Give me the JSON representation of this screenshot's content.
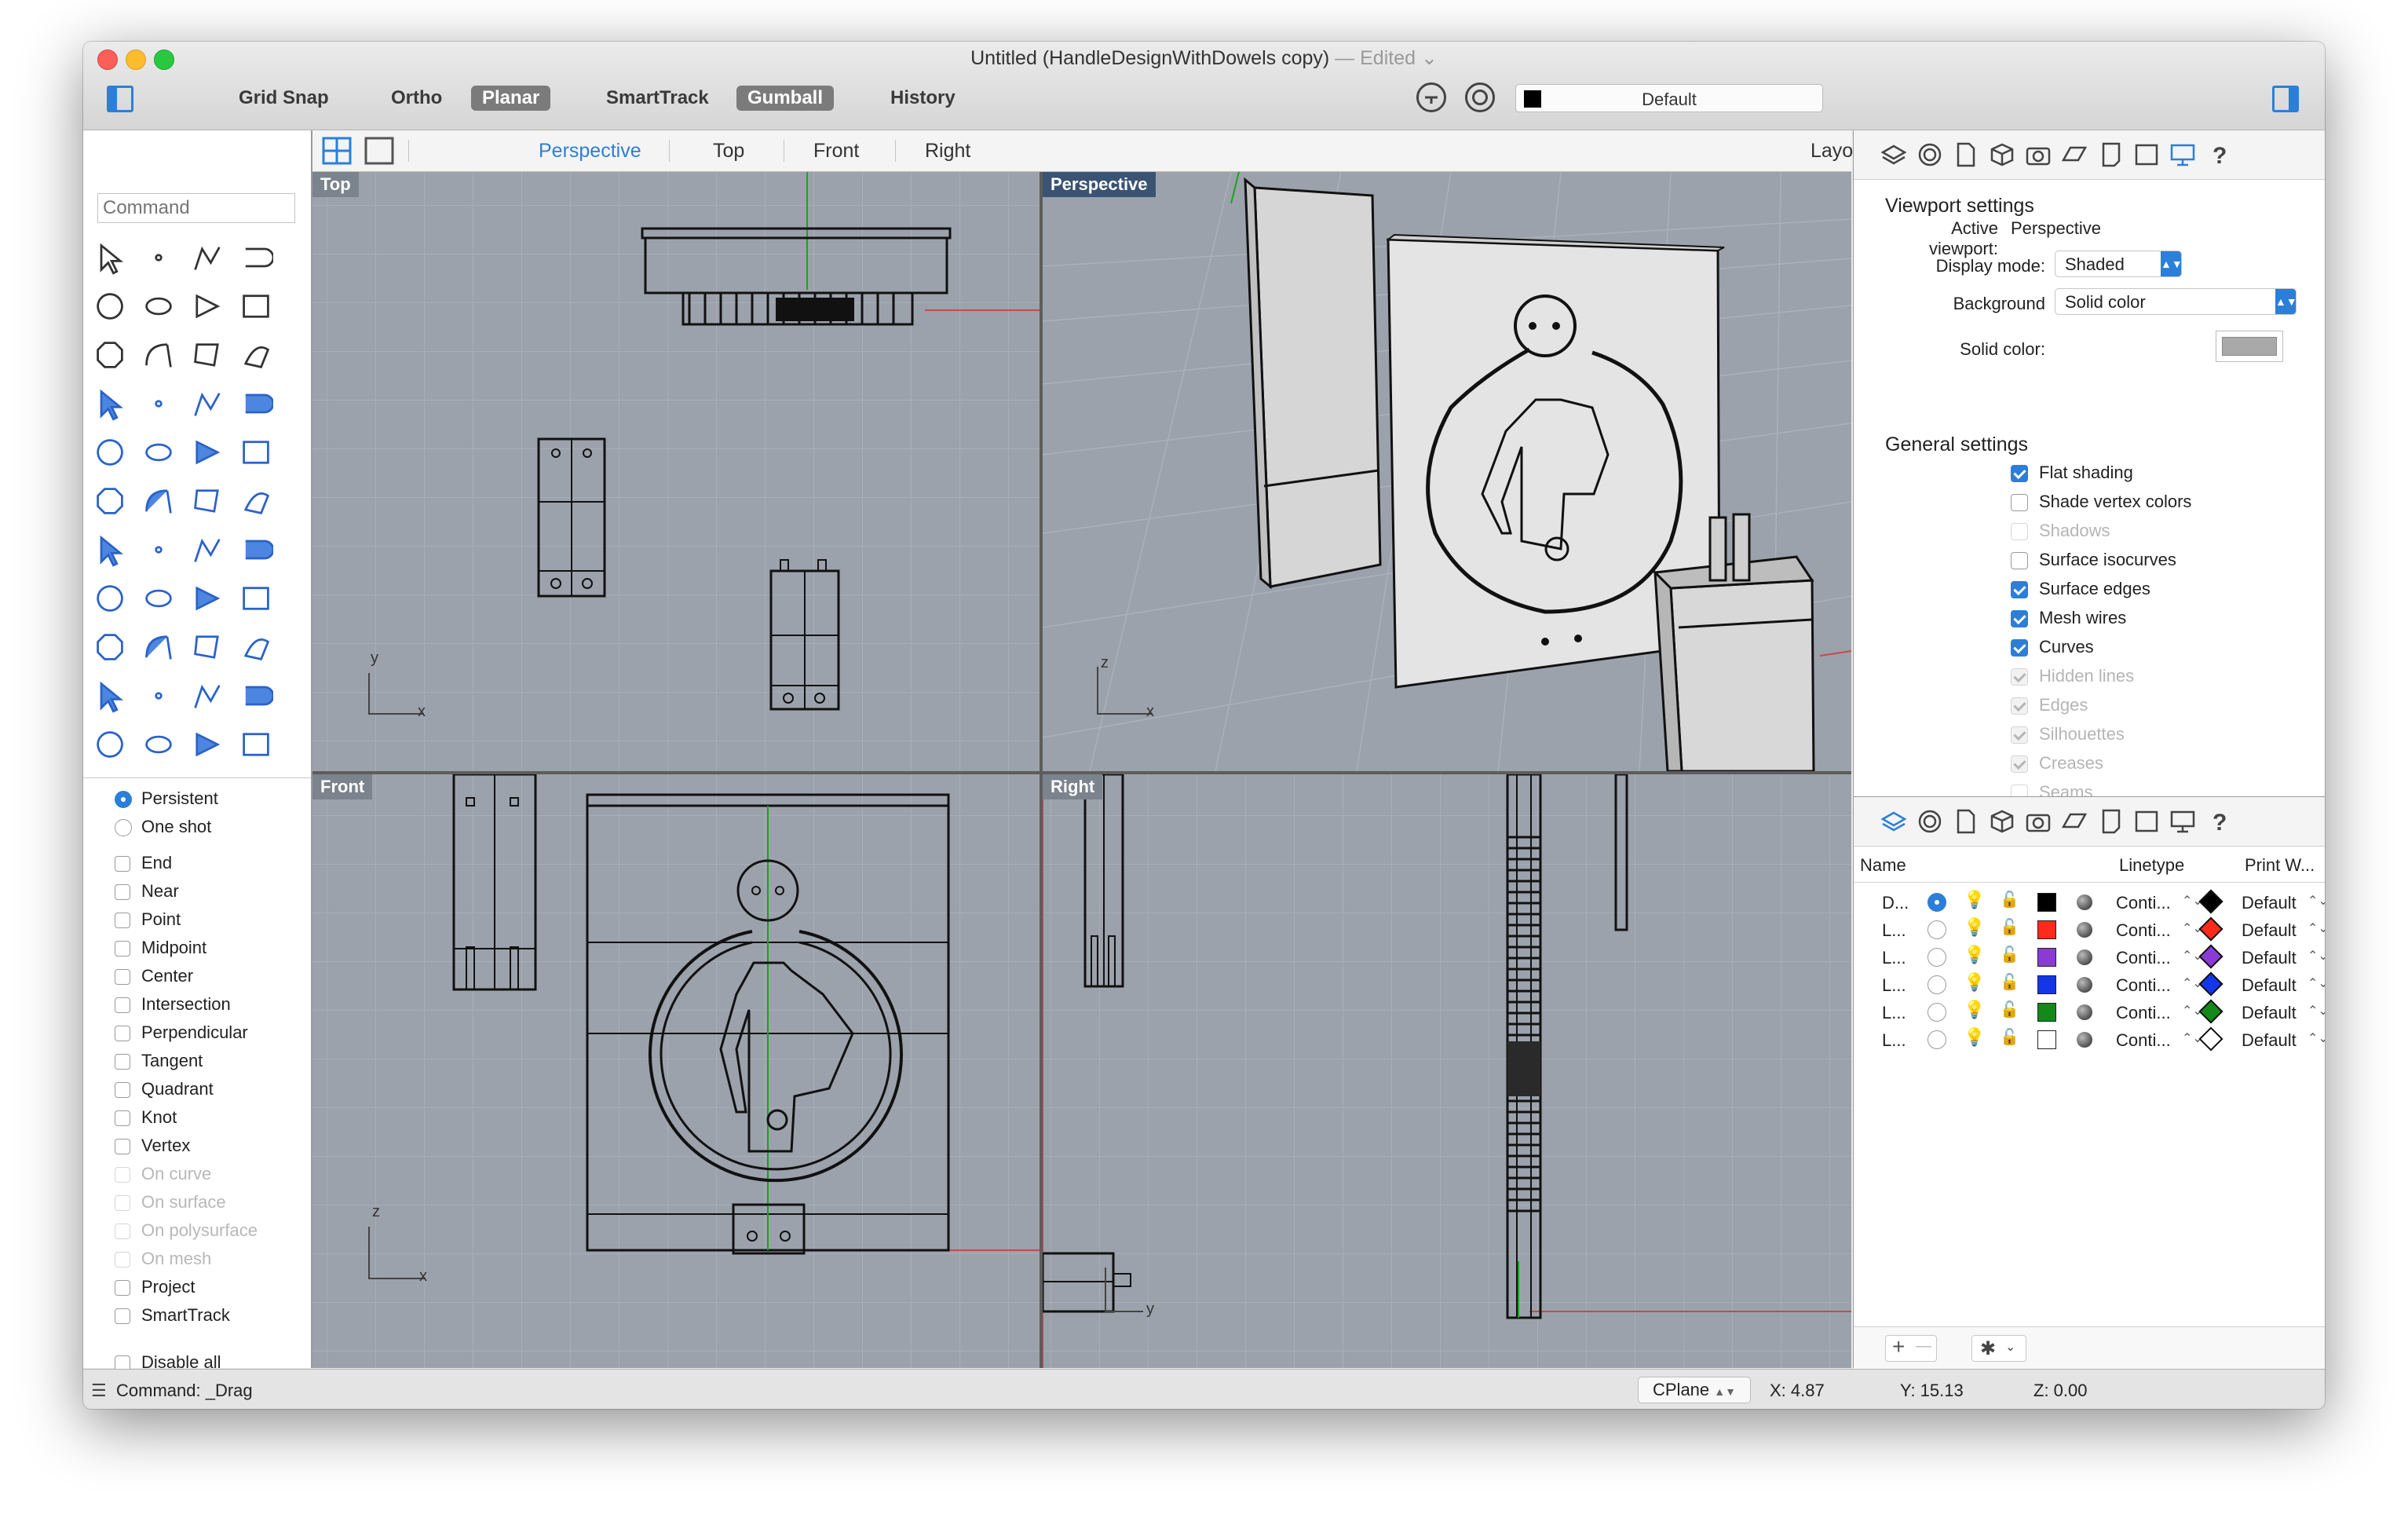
{
  "window": {
    "title": "Untitled (HandleDesignWithDowels copy)",
    "edited": "— Edited ⌄"
  },
  "toolbar": {
    "buttons": [
      {
        "label": "Grid Snap",
        "on": false
      },
      {
        "label": "Ortho",
        "on": false
      },
      {
        "label": "Planar",
        "on": true
      },
      {
        "label": "SmartTrack",
        "on": false
      },
      {
        "label": "Gumball",
        "on": true
      },
      {
        "label": "History",
        "on": false
      }
    ],
    "layer": "Default"
  },
  "command": {
    "placeholder": "Command",
    "status": "Command: _Drag"
  },
  "osnap": {
    "modes": [
      {
        "label": "Persistent",
        "on": true
      },
      {
        "label": "One shot",
        "on": false
      }
    ],
    "items": [
      {
        "label": "End",
        "dim": false
      },
      {
        "label": "Near",
        "dim": false
      },
      {
        "label": "Point",
        "dim": false
      },
      {
        "label": "Midpoint",
        "dim": false
      },
      {
        "label": "Center",
        "dim": false
      },
      {
        "label": "Intersection",
        "dim": false
      },
      {
        "label": "Perpendicular",
        "dim": false
      },
      {
        "label": "Tangent",
        "dim": false
      },
      {
        "label": "Quadrant",
        "dim": false
      },
      {
        "label": "Knot",
        "dim": false
      },
      {
        "label": "Vertex",
        "dim": false
      },
      {
        "label": "On curve",
        "dim": true
      },
      {
        "label": "On surface",
        "dim": true
      },
      {
        "label": "On polysurface",
        "dim": true
      },
      {
        "label": "On mesh",
        "dim": true
      },
      {
        "label": "Project",
        "dim": false
      },
      {
        "label": "SmartTrack",
        "dim": false
      },
      {
        "label": "Disable all",
        "dim": false
      }
    ]
  },
  "viewport_tabs": {
    "tabs": [
      "Perspective",
      "Top",
      "Front",
      "Right"
    ],
    "active": "Perspective",
    "layouts": "Layouts..."
  },
  "viewports": {
    "top": "Top",
    "perspective": "Perspective",
    "front": "Front",
    "right": "Right"
  },
  "axes": {
    "x": "x",
    "y": "y",
    "z": "z"
  },
  "viewport_settings": {
    "title": "Viewport settings",
    "active_label": "Active viewport:",
    "active_value": "Perspective",
    "display_label": "Display mode:",
    "display_value": "Shaded",
    "background_label": "Background",
    "background_value": "Solid color",
    "solid_label": "Solid color:",
    "solid_color": "#a9a9a9"
  },
  "general_settings": {
    "title": "General settings",
    "items": [
      {
        "label": "Flat shading",
        "checked": true,
        "dim": false
      },
      {
        "label": "Shade vertex colors",
        "checked": false,
        "dim": false
      },
      {
        "label": "Shadows",
        "checked": false,
        "dim": true
      },
      {
        "label": "Surface isocurves",
        "checked": false,
        "dim": false
      },
      {
        "label": "Surface edges",
        "checked": true,
        "dim": false
      },
      {
        "label": "Mesh wires",
        "checked": true,
        "dim": false
      },
      {
        "label": "Curves",
        "checked": true,
        "dim": false
      },
      {
        "label": "Hidden lines",
        "checked": true,
        "dim": true
      },
      {
        "label": "Edges",
        "checked": true,
        "dim": true
      },
      {
        "label": "Silhouettes",
        "checked": true,
        "dim": true
      },
      {
        "label": "Creases",
        "checked": true,
        "dim": true
      },
      {
        "label": "Seams",
        "checked": false,
        "dim": true
      }
    ]
  },
  "layers": {
    "headers": {
      "name": "Name",
      "linetype": "Linetype",
      "print": "Print W..."
    },
    "rows": [
      {
        "name": "D...",
        "current": true,
        "color": "#000000",
        "linetype": "Conti...",
        "print_color": "#000000",
        "print": "Default"
      },
      {
        "name": "L...",
        "current": false,
        "color": "#ff2a1a",
        "linetype": "Conti...",
        "print_color": "#ff2a1a",
        "print": "Default"
      },
      {
        "name": "L...",
        "current": false,
        "color": "#8a3bd6",
        "linetype": "Conti...",
        "print_color": "#8a3bd6",
        "print": "Default"
      },
      {
        "name": "L...",
        "current": false,
        "color": "#1236e8",
        "linetype": "Conti...",
        "print_color": "#1236e8",
        "print": "Default"
      },
      {
        "name": "L...",
        "current": false,
        "color": "#15881a",
        "linetype": "Conti...",
        "print_color": "#15881a",
        "print": "Default"
      },
      {
        "name": "L...",
        "current": false,
        "color": "#ffffff",
        "linetype": "Conti...",
        "print_color": "#ffffff",
        "print": "Default"
      }
    ],
    "add": "+",
    "remove": "—"
  },
  "status": {
    "cplane": "CPlane",
    "x": "X: 4.87",
    "y": "Y: 15.13",
    "z": "Z: 0.00"
  },
  "colors": {
    "accent": "#2b7fd8",
    "viewport_bg": "#9ba2ac",
    "active_label_bg": "#3a5373"
  }
}
